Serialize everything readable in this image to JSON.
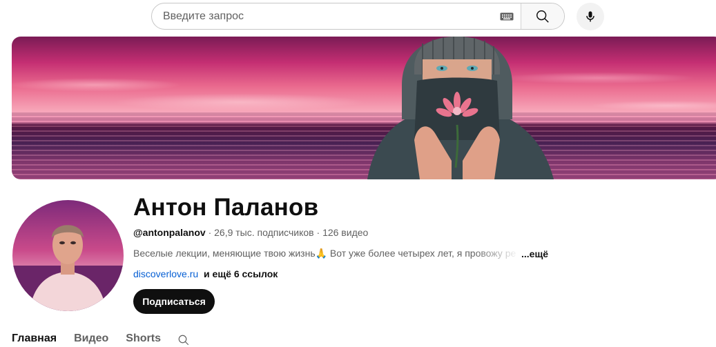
{
  "search": {
    "placeholder": "Введите запрос"
  },
  "channel": {
    "name": "Антон Паланов",
    "handle": "@antonpalanov",
    "subscribers": "26,9 тыс. подписчиков",
    "videos": "126 видео",
    "description": "Веселые лекции, меняющие твою жизнь🙏 Вот уже более четырех лет, я провожу ре",
    "more_label": "...ещё",
    "link_url": "discoverlove.ru",
    "link_more": "и ещё 6 ссылок",
    "subscribe_label": "Подписаться"
  },
  "tabs": [
    {
      "label": "Главная",
      "active": true
    },
    {
      "label": "Видео",
      "active": false
    },
    {
      "label": "Shorts",
      "active": false
    }
  ],
  "colors": {
    "accent_link": "#065fd4",
    "subscribe_bg": "#0f0f0f"
  }
}
